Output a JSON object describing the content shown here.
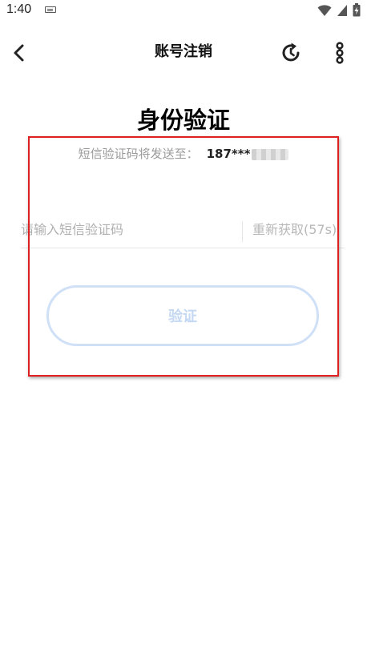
{
  "status_bar": {
    "time": "1:40",
    "icons": [
      "keyboard-icon",
      "wifi-icon",
      "signal-icon",
      "battery-charging-icon"
    ]
  },
  "nav": {
    "title": "账号注销",
    "icons": [
      "back-arrow-icon",
      "refresh-icon",
      "more-vertical-icon"
    ]
  },
  "main": {
    "title": "身份验证",
    "sms_label": "短信验证码将发送至：",
    "phone_prefix": "187***",
    "input_placeholder": "请输入短信验证码",
    "input_value": "",
    "resend_label": "重新获取(57s)",
    "verify_label": "验证"
  },
  "colors": {
    "highlight_border": "#e02020",
    "button_border": "#cfe0f7",
    "button_text": "#c4d8f3",
    "muted_text": "#9a9a9a"
  }
}
